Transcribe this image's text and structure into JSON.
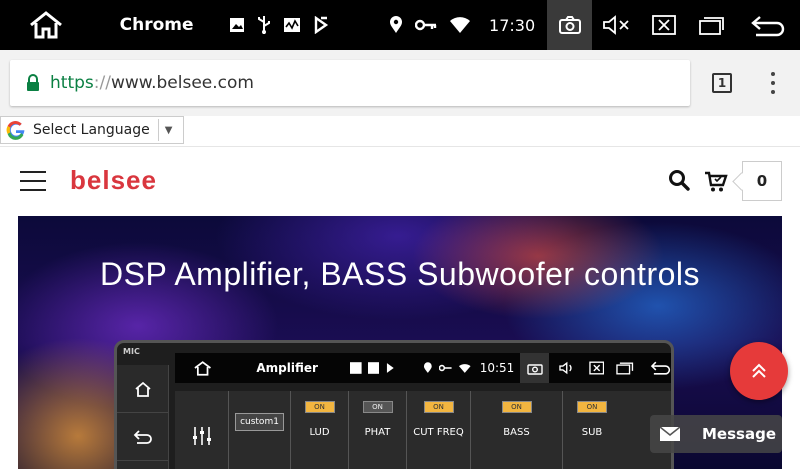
{
  "status_bar": {
    "app_name": "Chrome",
    "time": "17:30",
    "icons_left": [
      "image-icon",
      "usb-icon",
      "activity-icon",
      "download-icon"
    ],
    "icons_right": [
      "location-icon",
      "key-icon",
      "wifi-icon"
    ]
  },
  "browser": {
    "url_scheme": "https",
    "url_separator": "://",
    "url_host": "www.belsee.com",
    "tab_count": "1"
  },
  "translate": {
    "label": "Select Language",
    "arrow": "▼"
  },
  "site": {
    "logo": "belsee",
    "cart_count": "0"
  },
  "banner": {
    "title": "DSP Amplifier, BASS Subwoofer controls",
    "device": {
      "mic": "MIC",
      "app_title": "Amplifier",
      "time": "10:51",
      "preset": "custom1",
      "columns": [
        {
          "label": "LUD",
          "button": "ON",
          "state": "on"
        },
        {
          "label": "PHAT",
          "button": "ON",
          "state": "off"
        },
        {
          "label": "CUT FREQ",
          "button": "ON",
          "state": "on"
        },
        {
          "label": "BASS",
          "button": "ON",
          "state": "on"
        },
        {
          "label": "SUB",
          "button": "ON",
          "state": "on"
        }
      ]
    }
  },
  "floating": {
    "message_label": "Message"
  },
  "colors": {
    "brand_red": "#d9363e",
    "secure_green": "#0b8043",
    "fab_red": "#e63a3a",
    "on_button": "#f2b540"
  }
}
